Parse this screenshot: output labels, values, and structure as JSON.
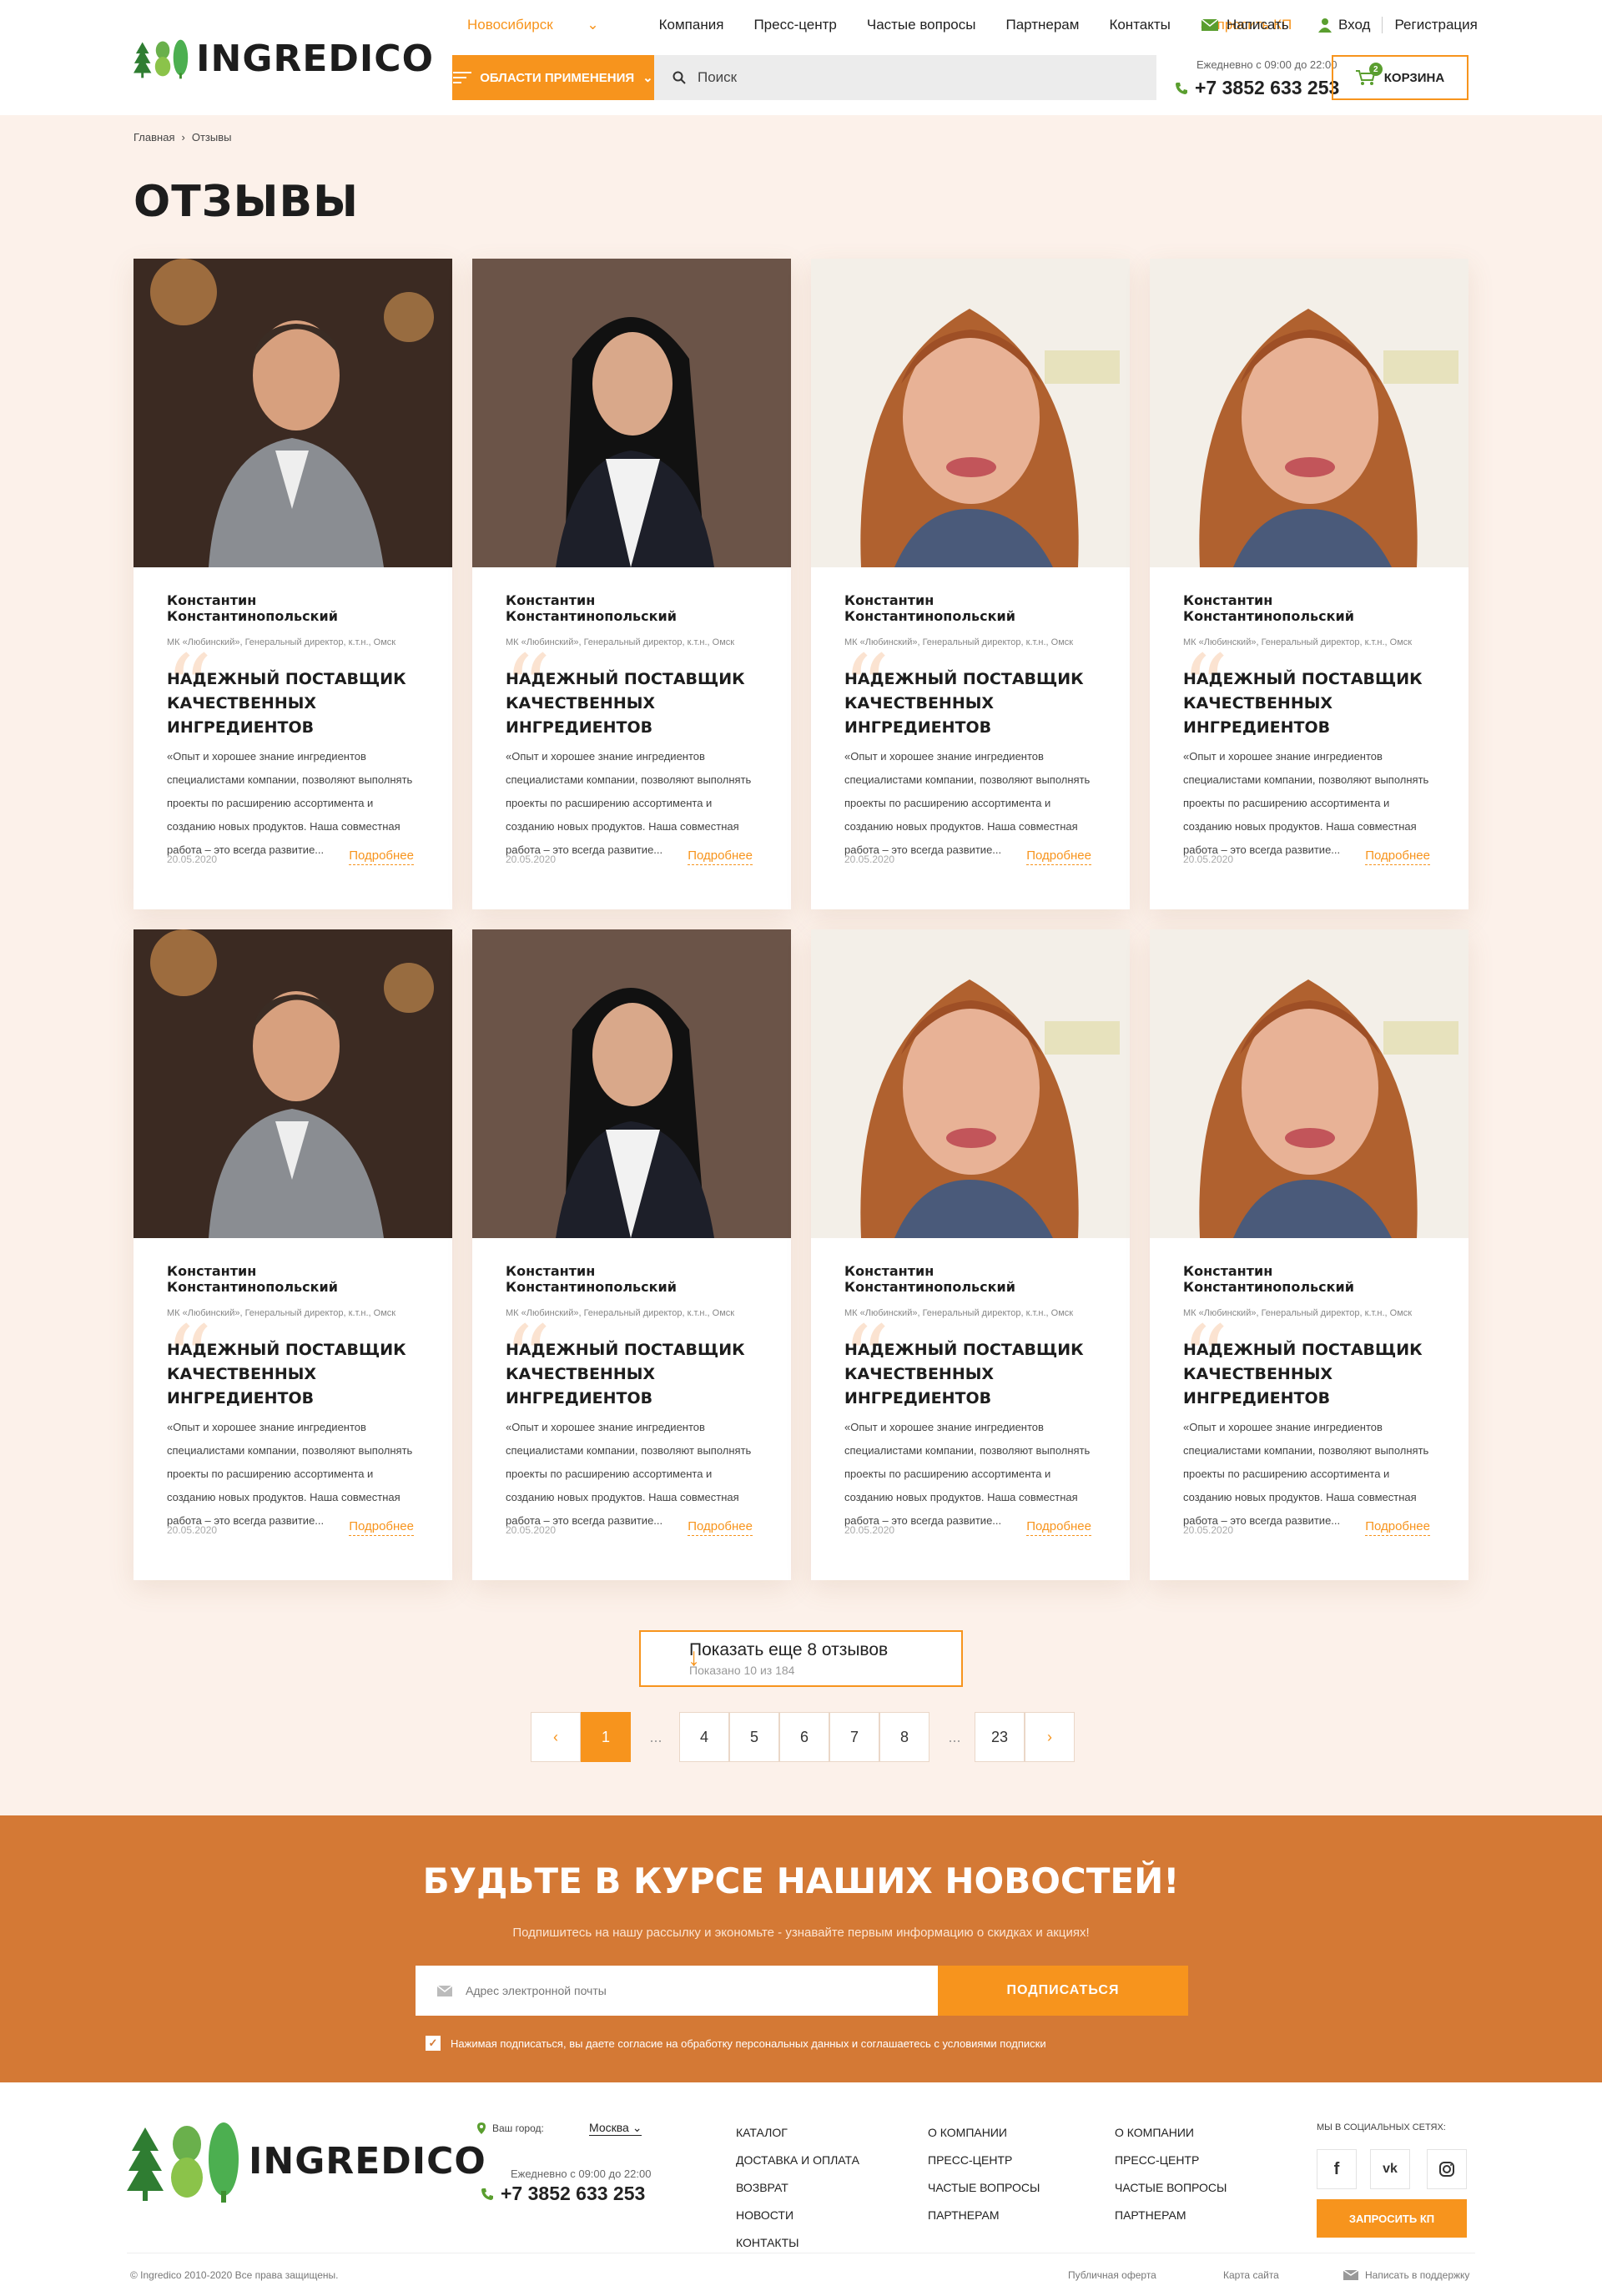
{
  "header": {
    "logo_text": "INGREDICO",
    "nav": {
      "city": "Новосибирск",
      "company": "Компания",
      "press": "Пресс-центр",
      "faq": "Частые вопросы",
      "partners": "Партнерам",
      "contacts": "Контакты",
      "request": "Запросить КП"
    },
    "write": "Написать",
    "login": "Вход",
    "register": "Регистрация",
    "areas_button": "Области применения",
    "search_placeholder": "Поиск",
    "hours": "Ежедневно с 09:00 до 22:00",
    "phone": "+7 3852 633 253",
    "cart_label": "Корзина",
    "cart_count": "2"
  },
  "breadcrumb": {
    "home": "Главная",
    "current": "Отзывы"
  },
  "page_title": "ОТЗЫВЫ",
  "reviews": [
    {
      "name": "Константин Константинопольский",
      "role": "МК «Любинский», Генеральный директор, к.т.н., Омск",
      "headline": "НАДЕЖНЫЙ ПОСТАВЩИК КАЧЕСТВЕННЫХ ИНГРЕДИЕНТОВ",
      "text": "«Опыт и хорошее знание ингредиентов специалистами компании, позволяют выполнять проекты по расширению ассортимента и созданию новых продуктов. Наша совместная работа – это всегда развитие...",
      "date": "20.05.2020",
      "more": "Подробнее"
    },
    {
      "name": "Константин Константинопольский",
      "role": "МК «Любинский», Генеральный директор, к.т.н., Омск",
      "headline": "НАДЕЖНЫЙ ПОСТАВЩИК КАЧЕСТВЕННЫХ ИНГРЕДИЕНТОВ",
      "text": "«Опыт и хорошее знание ингредиентов специалистами компании, позволяют выполнять проекты по расширению ассортимента и созданию новых продуктов. Наша совместная работа – это всегда развитие...",
      "date": "20.05.2020",
      "more": "Подробнее"
    },
    {
      "name": "Константин Константинопольский",
      "role": "МК «Любинский», Генеральный директор, к.т.н., Омск",
      "headline": "НАДЕЖНЫЙ ПОСТАВЩИК КАЧЕСТВЕННЫХ ИНГРЕДИЕНТОВ",
      "text": "«Опыт и хорошее знание ингредиентов специалистами компании, позволяют выполнять проекты по расширению ассортимента и созданию новых продуктов. Наша совместная работа – это всегда развитие...",
      "date": "20.05.2020",
      "more": "Подробнее"
    },
    {
      "name": "Константин Константинопольский",
      "role": "МК «Любинский», Генеральный директор, к.т.н., Омск",
      "headline": "НАДЕЖНЫЙ ПОСТАВЩИК КАЧЕСТВЕННЫХ ИНГРЕДИЕНТОВ",
      "text": "«Опыт и хорошее знание ингредиентов специалистами компании, позволяют выполнять проекты по расширению ассортимента и созданию новых продуктов. Наша совместная работа – это всегда развитие...",
      "date": "20.05.2020",
      "more": "Подробнее"
    },
    {
      "name": "Константин Константинопольский",
      "role": "МК «Любинский», Генеральный директор, к.т.н., Омск",
      "headline": "НАДЕЖНЫЙ ПОСТАВЩИК КАЧЕСТВЕННЫХ ИНГРЕДИЕНТОВ",
      "text": "«Опыт и хорошее знание ингредиентов специалистами компании, позволяют выполнять проекты по расширению ассортимента и созданию новых продуктов. Наша совместная работа – это всегда развитие...",
      "date": "20.05.2020",
      "more": "Подробнее"
    },
    {
      "name": "Константин Константинопольский",
      "role": "МК «Любинский», Генеральный директор, к.т.н., Омск",
      "headline": "НАДЕЖНЫЙ ПОСТАВЩИК КАЧЕСТВЕННЫХ ИНГРЕДИЕНТОВ",
      "text": "«Опыт и хорошее знание ингредиентов специалистами компании, позволяют выполнять проекты по расширению ассортимента и созданию новых продуктов. Наша совместная работа – это всегда развитие...",
      "date": "20.05.2020",
      "more": "Подробнее"
    },
    {
      "name": "Константин Константинопольский",
      "role": "МК «Любинский», Генеральный директор, к.т.н., Омск",
      "headline": "НАДЕЖНЫЙ ПОСТАВЩИК КАЧЕСТВЕННЫХ ИНГРЕДИЕНТОВ",
      "text": "«Опыт и хорошее знание ингредиентов специалистами компании, позволяют выполнять проекты по расширению ассортимента и созданию новых продуктов. Наша совместная работа – это всегда развитие...",
      "date": "20.05.2020",
      "more": "Подробнее"
    },
    {
      "name": "Константин Константинопольский",
      "role": "МК «Любинский», Генеральный директор, к.т.н., Омск",
      "headline": "НАДЕЖНЫЙ ПОСТАВЩИК КАЧЕСТВЕННЫХ ИНГРЕДИЕНТОВ",
      "text": "«Опыт и хорошее знание ингредиентов специалистами компании, позволяют выполнять проекты по расширению ассортимента и созданию новых продуктов. Наша совместная работа – это всегда развитие...",
      "date": "20.05.2020",
      "more": "Подробнее"
    }
  ],
  "show_more": {
    "label": "Показать еще 8 отзывов",
    "shown": "Показано 10 из 184"
  },
  "pagination": {
    "prev": "‹",
    "pages": [
      "1",
      "...",
      "4",
      "5",
      "6",
      "7",
      "8",
      "...",
      "23"
    ],
    "next": "›",
    "current": "1"
  },
  "newsletter": {
    "title": "БУДЬТЕ В КУРСЕ НАШИХ НОВОСТЕЙ!",
    "subtitle": "Подпишитесь на нашу рассылку и экономьте - узнавайте первым информацию о скидках и акциях!",
    "email_placeholder": "Адрес электронной почты",
    "button": "Подписаться",
    "agree": "Нажимая подписаться, вы даете согласие на обработку персональных данных и соглашаетесь с условиями подписки"
  },
  "footer": {
    "city_label": "Ваш город:",
    "city": "Москва",
    "hours": "Ежедневно с 09:00 до 22:00",
    "phone": "+7 3852 633 253",
    "col1": [
      "Каталог",
      "Доставка и оплата",
      "Возврат",
      "Новости",
      "Контакты"
    ],
    "col2": [
      "О компании",
      "Пресс-центр",
      "Частые вопросы",
      "Партнерам"
    ],
    "col3": [
      "О компании",
      "Пресс-центр",
      "Частые вопросы",
      "Партнерам"
    ],
    "social_label": "Мы в социальных сетях:",
    "request_button": "Запросить КП",
    "copyright": "© Ingredico 2010-2020 Все права защищены.",
    "offer": "Публичная оферта",
    "sitemap": "Карта сайта",
    "support": "Написать в поддержку"
  },
  "colors": {
    "accent": "#f7941d",
    "newsletter_bg": "#d47935",
    "page_bg": "#fcf1ea",
    "logo_green": "#3f8f2f"
  }
}
